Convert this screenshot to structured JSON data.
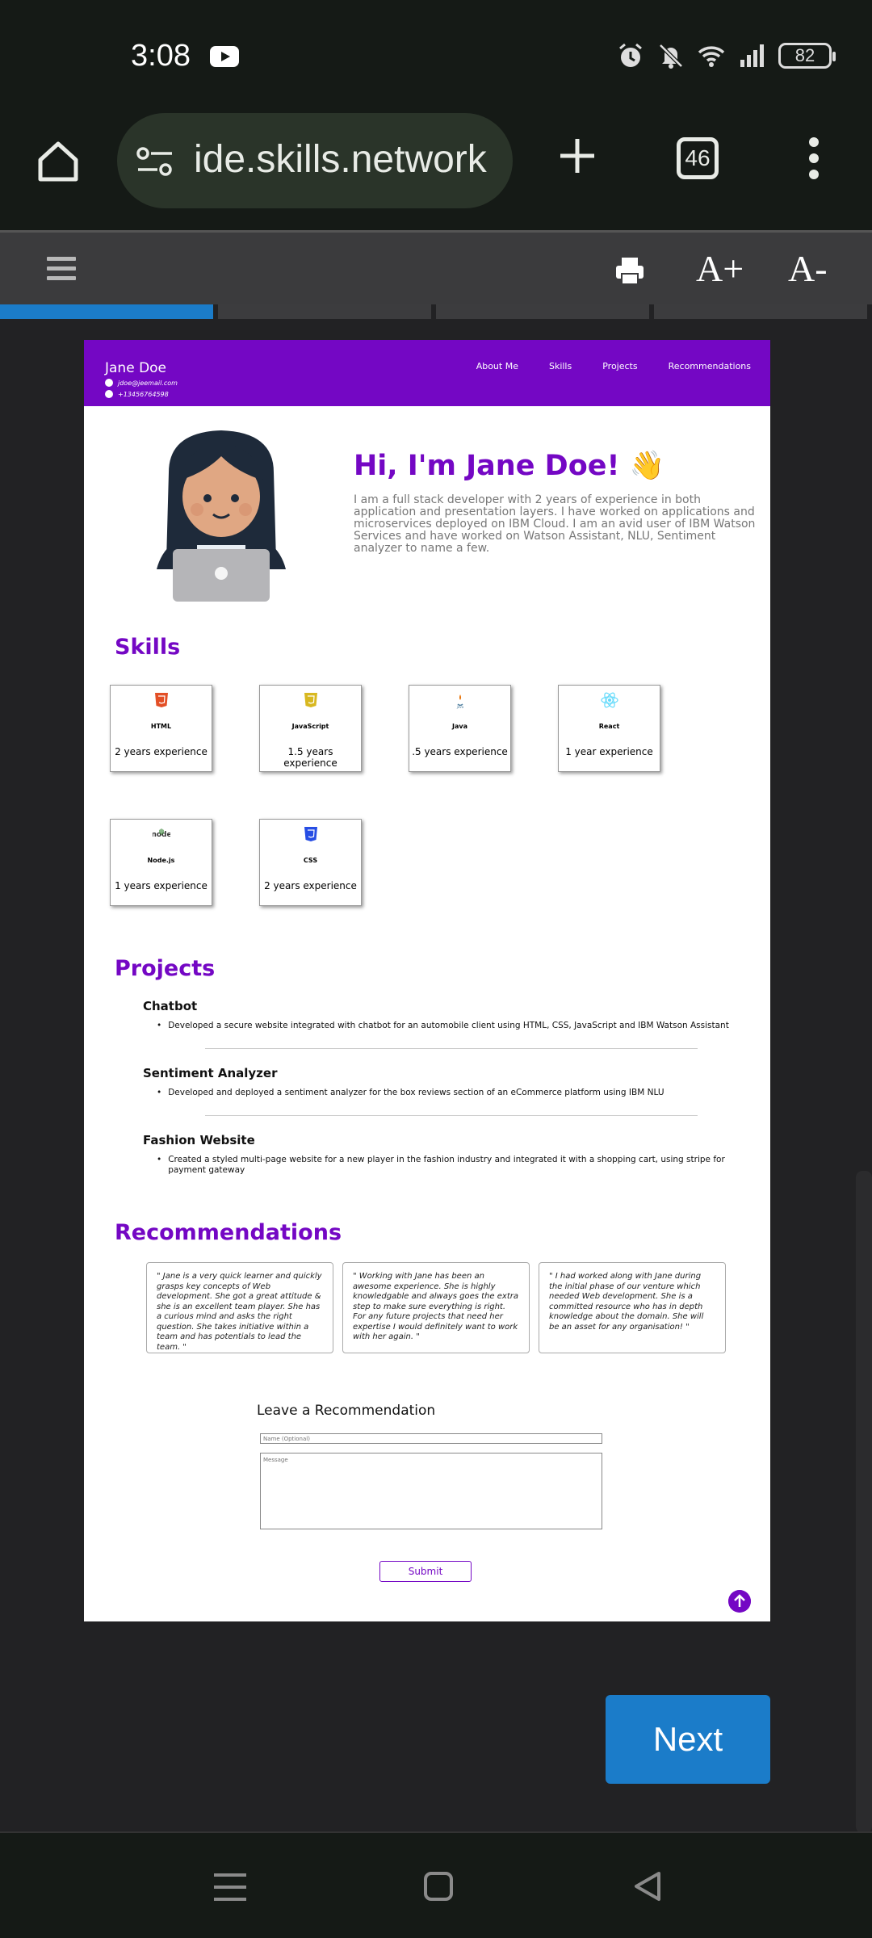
{
  "status_bar": {
    "time": "3:08",
    "battery": "82"
  },
  "browser": {
    "url": "ide.skills.network",
    "tab_count": "46"
  },
  "reader_toolbar": {
    "font_increase": "A+",
    "font_decrease": "A-"
  },
  "progress": {
    "segments_total": 4,
    "segments_completed": 1
  },
  "site": {
    "name": "Jane Doe",
    "email": "jdoe@jeemail.com",
    "phone": "+13456764598",
    "nav": [
      "About Me",
      "Skills",
      "Projects",
      "Recommendations"
    ],
    "hero_title": "Hi, I'm Jane Doe! 👋",
    "hero_text": "I am a full stack developer with 2 years of experience in both application and presentation layers. I have worked on applications and microservices deployed on IBM Cloud. I am an avid user of IBM Watson Services and have worked on Watson Assistant, NLU, Sentiment analyzer to name a few.",
    "skills_title": "Skills",
    "skills": [
      {
        "name": "HTML",
        "experience": "2 years experience",
        "icon": "html5-icon",
        "color": "#e34f26"
      },
      {
        "name": "JavaScript",
        "experience": "1.5 years experience",
        "icon": "javascript-icon",
        "color": "#d8b820"
      },
      {
        "name": "Java",
        "experience": ".5 years experience",
        "icon": "java-icon",
        "color": "#5382a1"
      },
      {
        "name": "React",
        "experience": "1 year experience",
        "icon": "react-icon",
        "color": "#61dafb"
      },
      {
        "name": "Node.js",
        "experience": "1 years experience",
        "icon": "nodejs-icon",
        "color": "#3c873a"
      },
      {
        "name": "CSS",
        "experience": "2 years experience",
        "icon": "css3-icon",
        "color": "#264de4"
      }
    ],
    "projects_title": "Projects",
    "projects": [
      {
        "title": "Chatbot",
        "description": "Developed a secure website integrated with chatbot for an automobile client using HTML, CSS, JavaScript and IBM Watson Assistant"
      },
      {
        "title": "Sentiment Analyzer",
        "description": "Developed and deployed a sentiment analyzer for the box reviews section of an eCommerce platform using IBM NLU"
      },
      {
        "title": "Fashion Website",
        "description": "Created a styled multi-page website for a new player in the fashion industry and integrated it with a shopping cart, using stripe for payment gateway"
      }
    ],
    "recommendations_title": "Recommendations",
    "recommendations": [
      "\" Jane is a very quick learner and quickly grasps key concepts of Web development. She got a great attitude & she is an excellent team player. She has a curious mind and asks the right question. She takes initiative within a team and has potentials to lead the team. \"",
      "\" Working with Jane has been an awesome experience. She is highly knowledgable and always goes the extra step to make sure everything is right. For any future projects that need her expertise I would definitely want to work with her again. \"",
      "\" I had worked along with Jane during the initial phase of our venture which needed Web development. She is a committed resource who has in depth knowledge about the domain. She will be an asset for any organisation! \""
    ],
    "leave_recommendation": {
      "title": "Leave a Recommendation",
      "name_placeholder": "Name (Optional)",
      "message_placeholder": "Message",
      "submit_label": "Submit"
    },
    "accent_color": "#7407c4"
  },
  "next_button": "Next"
}
